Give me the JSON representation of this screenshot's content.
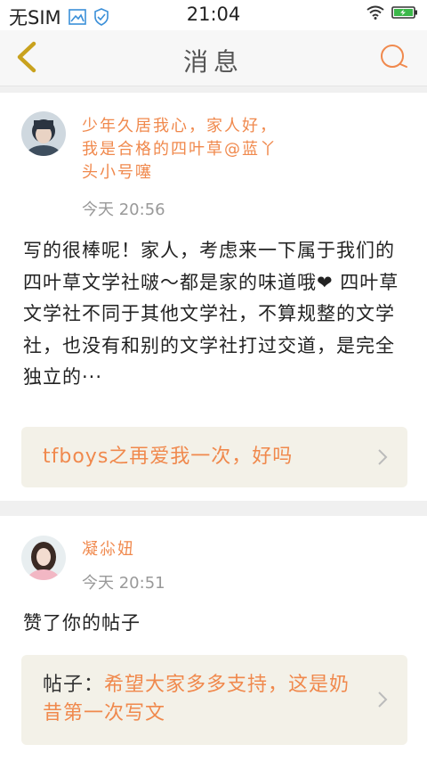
{
  "status_bar": {
    "carrier": "无SIM",
    "time": "21:04",
    "icons": [
      "image-icon",
      "shield-check-icon",
      "wifi-icon",
      "battery-charging-icon"
    ]
  },
  "nav": {
    "title": "消息",
    "back_icon": "chevron-left-icon",
    "search_icon": "search-icon"
  },
  "colors": {
    "accent": "#f0894d",
    "quote_bg": "#f3f1e8",
    "page_bg": "#f0f0f0"
  },
  "messages": [
    {
      "author": "少年久居我心，家人好，我是合格的四叶草@蓝丫头小号噻",
      "time": "今天 20:56",
      "body": "写的很棒呢！家人，考虑来一下属于我们的四叶草文学社啵～都是家的味道哦❤ 四叶草文学社不同于其他文学社，不算规整的文学社，也没有和别的文学社打过交道，是完全独立的···",
      "quote_prefix": "",
      "quote": "tfboys之再爱我一次，好吗"
    },
    {
      "author": "凝尛妞",
      "time": "今天 20:51",
      "body": "赞了你的帖子",
      "quote_prefix": "帖子：",
      "quote": "希望大家多多支持，这是奶昔第一次写文"
    }
  ]
}
